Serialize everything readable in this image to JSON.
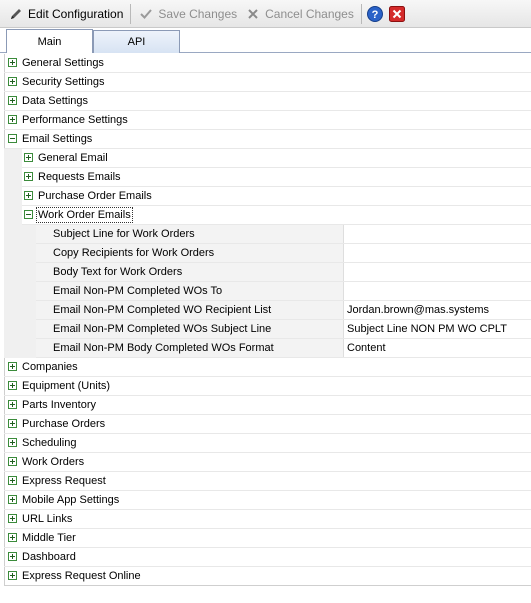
{
  "toolbar": {
    "edit_label": "Edit Configuration",
    "save_label": "Save Changes",
    "cancel_label": "Cancel Changes",
    "edit_icon": "pencil-icon",
    "save_icon": "checkmark-icon",
    "cancel_icon": "x-icon",
    "help_icon": "help-icon",
    "close_icon": "close-icon"
  },
  "tabs": {
    "main": "Main",
    "api": "API"
  },
  "tree": {
    "top1": [
      "General Settings",
      "Security Settings",
      "Data Settings",
      "Performance Settings",
      "Email Settings"
    ],
    "email_children": [
      "General Email",
      "Requests Emails",
      "Purchase Order Emails",
      "Work Order Emails"
    ],
    "work_order_props": [
      {
        "name": "Subject Line for Work Orders",
        "value": ""
      },
      {
        "name": "Copy Recipients for Work Orders",
        "value": ""
      },
      {
        "name": "Body Text for Work Orders",
        "value": ""
      },
      {
        "name": "Email Non-PM Completed WOs To",
        "value": ""
      },
      {
        "name": "Email Non-PM Completed WO Recipient List",
        "value": "Jordan.brown@mas.systems"
      },
      {
        "name": "Email Non-PM Completed WOs Subject Line",
        "value": "Subject Line NON PM WO CPLT"
      },
      {
        "name": "Email Non-PM Body Completed WOs Format",
        "value": "Content"
      }
    ],
    "top2": [
      "Companies",
      "Equipment (Units)",
      "Parts Inventory",
      "Purchase Orders",
      "Scheduling",
      "Work Orders",
      "Express Request",
      "Mobile App Settings",
      "URL Links",
      "Middle Tier",
      "Dashboard",
      "Express Request Online"
    ]
  }
}
